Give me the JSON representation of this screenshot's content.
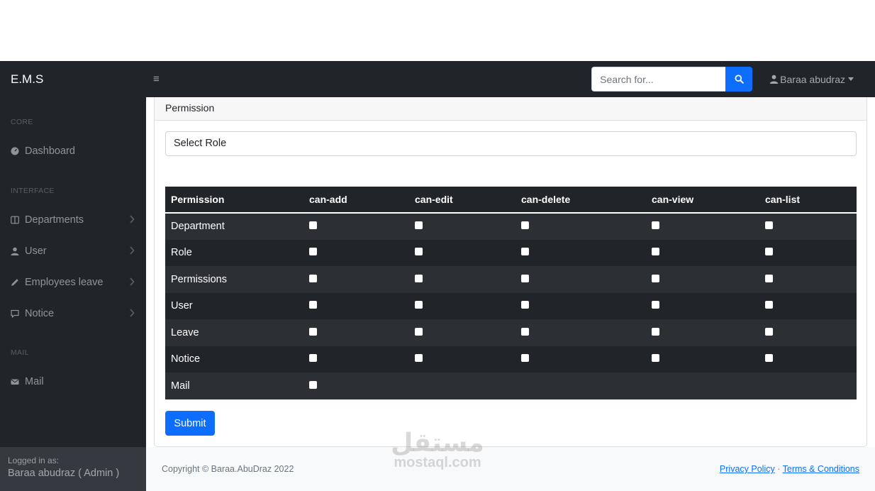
{
  "app": {
    "brand": "E.M.S"
  },
  "navbar": {
    "toggle_icon": "menu-icon",
    "search_placeholder": "Search for...",
    "search_icon": "search-icon",
    "user_name": "Baraa abudraz"
  },
  "sidebar": {
    "headings": {
      "core": "CORE",
      "interface": "INTERFACE",
      "mail": "MAIL"
    },
    "items": {
      "dashboard": {
        "label": "Dashboard",
        "icon": "dashboard-icon"
      },
      "departments": {
        "label": "Departments",
        "icon": "columns-icon"
      },
      "user": {
        "label": "User",
        "icon": "user-icon"
      },
      "employees_leave": {
        "label": "Employees leave",
        "icon": "pencil-icon"
      },
      "notice": {
        "label": "Notice",
        "icon": "comment-icon"
      },
      "mail": {
        "label": "Mail",
        "icon": "envelope-icon"
      }
    },
    "footer": {
      "logged_in_label": "Logged in as:",
      "user": "Baraa abudraz ( Admin )"
    }
  },
  "card": {
    "header": "Permission",
    "select_role": "Select Role",
    "table": {
      "columns": [
        "Permission",
        "can-add",
        "can-edit",
        "can-delete",
        "can-view",
        "can-list"
      ],
      "rows": [
        {
          "name": "Department",
          "checks": [
            true,
            true,
            true,
            true,
            true
          ]
        },
        {
          "name": "Role",
          "checks": [
            true,
            true,
            true,
            true,
            true
          ]
        },
        {
          "name": "Permissions",
          "checks": [
            true,
            true,
            true,
            true,
            true
          ]
        },
        {
          "name": "User",
          "checks": [
            true,
            true,
            true,
            true,
            true
          ]
        },
        {
          "name": "Leave",
          "checks": [
            true,
            true,
            true,
            true,
            true
          ]
        },
        {
          "name": "Notice",
          "checks": [
            true,
            true,
            true,
            true,
            true
          ]
        },
        {
          "name": "Mail",
          "checks": [
            true,
            false,
            false,
            false,
            false
          ]
        }
      ]
    },
    "submit": "Submit"
  },
  "footer": {
    "copyright": "Copyright © Baraa.AbuDraz 2022",
    "privacy": "Privacy Policy",
    "separator": "·",
    "terms": "Terms & Conditions"
  },
  "watermark": {
    "arabic": "مستقل",
    "latin": "mostaql.com"
  },
  "colors": {
    "dark": "#212529",
    "primary": "#0d6efd",
    "sidebar_footer": "#343a40"
  }
}
